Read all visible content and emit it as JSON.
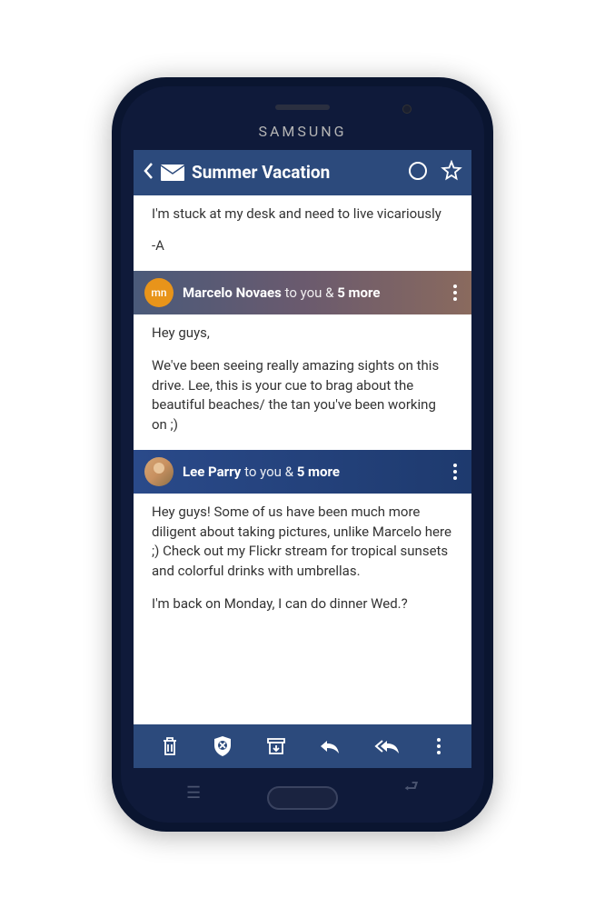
{
  "device": {
    "brand": "SAMSUNG"
  },
  "header": {
    "title": "Summer Vacation"
  },
  "messages": [
    {
      "body_lines": [
        "I'm stuck at my desk and need to live vicariously",
        "-A"
      ]
    },
    {
      "sender": {
        "initials": "mn",
        "name": "Marcelo Novaes",
        "to_text": " to you & ",
        "more_count": "5 more"
      },
      "body_lines": [
        "Hey guys,",
        "We've been seeing really amazing sights on this drive. Lee, this is your cue to brag about the beautiful beaches/ the tan you've been working on ;)"
      ]
    },
    {
      "sender": {
        "name": "Lee Parry",
        "to_text": " to you & ",
        "more_count": "5 more"
      },
      "body_lines": [
        "Hey guys! Some of us have been much more diligent about taking pictures, unlike Marcelo here ;) Check out my Flickr stream for tropical sunsets and colorful drinks with umbrellas.",
        "I'm back on Monday, I can do dinner Wed.?"
      ]
    }
  ]
}
